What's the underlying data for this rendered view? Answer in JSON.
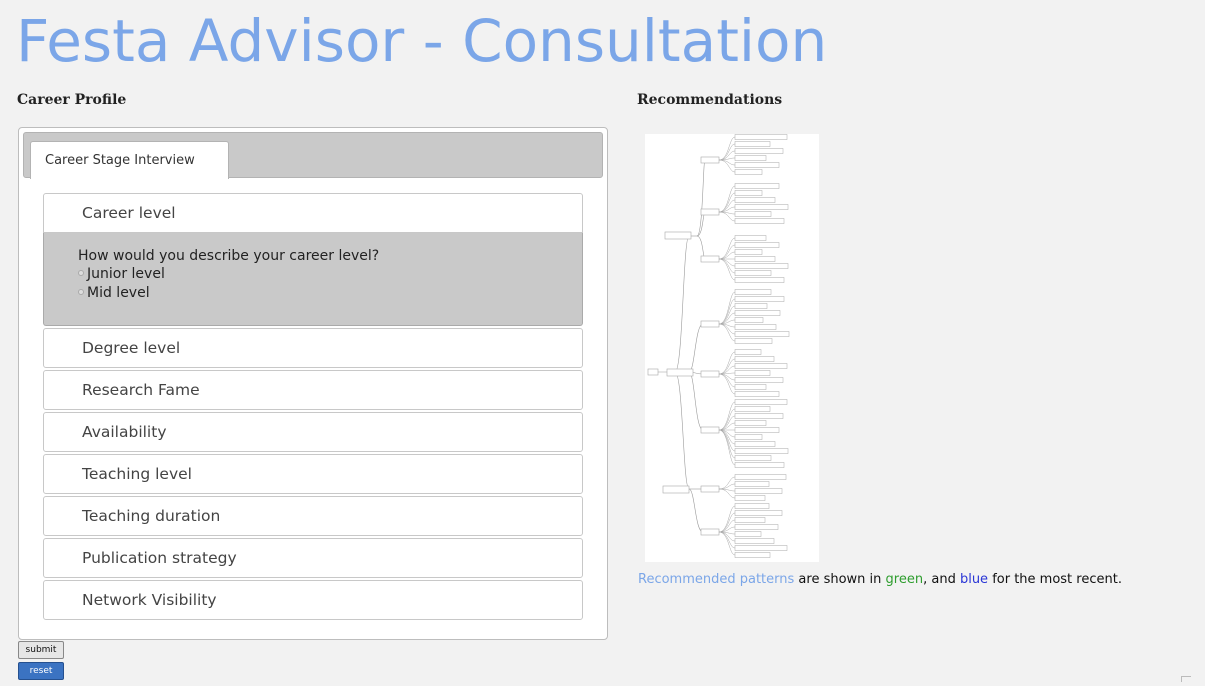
{
  "title": "Festa Advisor - Consultation",
  "left_heading": "Career Profile",
  "right_heading": "Recommendations",
  "tab": {
    "label": "Career Stage Interview"
  },
  "accordion": {
    "active": {
      "label": "Career level",
      "question": "How would you describe your career level?",
      "options": [
        "Junior level",
        "Mid level"
      ]
    },
    "sections": [
      "Degree level",
      "Research Fame",
      "Availability",
      "Teaching level",
      "Teaching duration",
      "Publication strategy",
      "Network Visibility"
    ]
  },
  "buttons": {
    "submit": "submit",
    "reset": "reset"
  },
  "legend": {
    "link": "Recommended patterns",
    "text1": " are shown in ",
    "green": "green",
    "text2": ", and ",
    "blue": "blue",
    "text3": " for the most recent."
  },
  "colors": {
    "title": "#7ba6e8",
    "green": "#2e9d2e",
    "blue": "#2a36d6",
    "reset_button": "#3b73c2"
  },
  "icons": {
    "tree": "decision-tree-image"
  }
}
